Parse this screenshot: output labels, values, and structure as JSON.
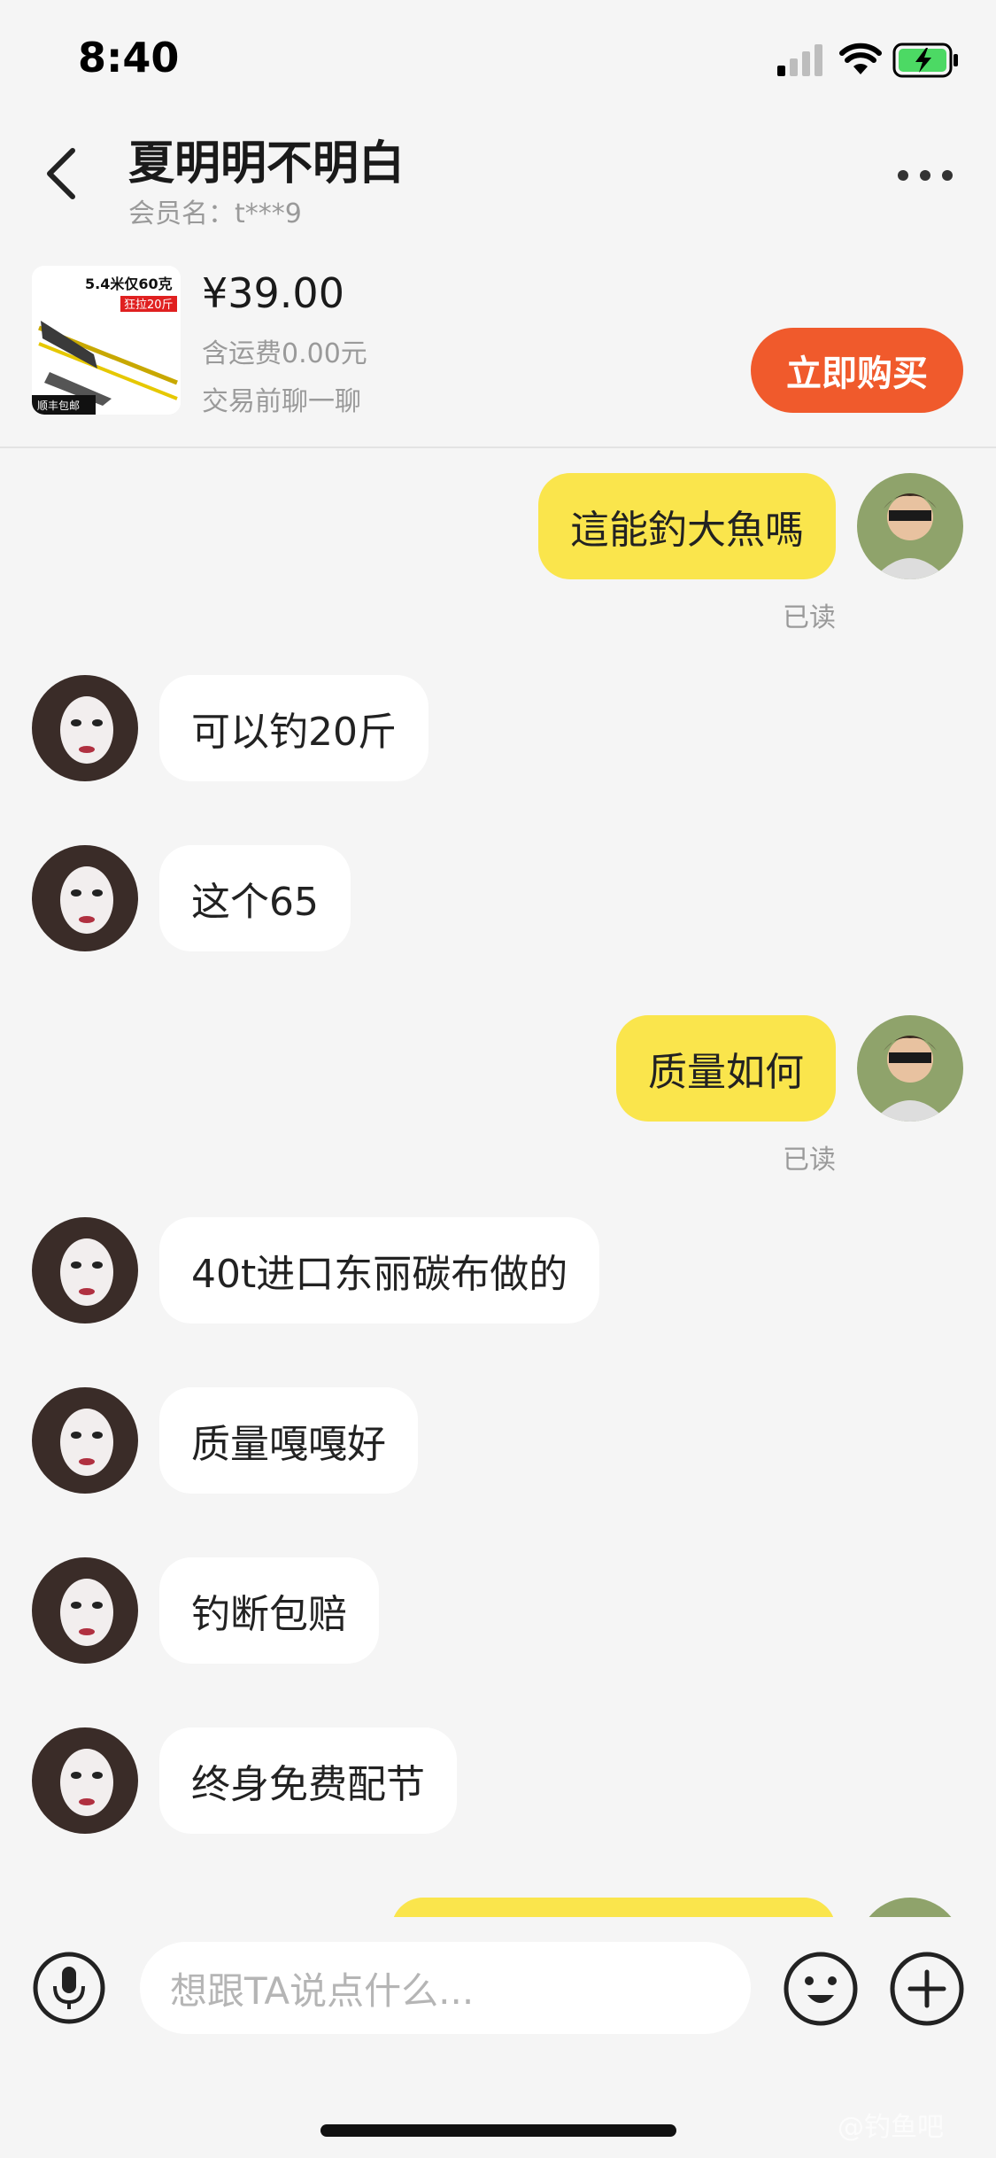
{
  "status_bar": {
    "time": "8:40",
    "icons": [
      "signal-icon",
      "wifi-icon",
      "battery-charging-icon"
    ]
  },
  "header": {
    "title": "夏明明不明白",
    "member": "会员名：t***9",
    "back_icon": "chevron-left-icon",
    "more_icon": "more-dots-icon"
  },
  "product": {
    "image_text": {
      "main": "5.4米仅60克",
      "tag": "狂拉20斤",
      "badge": "顺丰包邮"
    },
    "price": "¥39.00",
    "shipping": "含运费0.00元",
    "chat_hint": "交易前聊一聊",
    "buy_label": "立即购买",
    "buy_color": "#f05a2c"
  },
  "messages": [
    {
      "side": "out",
      "text": "這能釣大魚嗎",
      "status": "已读"
    },
    {
      "side": "in",
      "text": "可以钓20斤"
    },
    {
      "side": "in",
      "text": "这个65"
    },
    {
      "side": "out",
      "text": "质量如何",
      "status": "已读"
    },
    {
      "side": "in",
      "text": "40t进口东丽碳布做的"
    },
    {
      "side": "in",
      "text": "质量嘎嘎好"
    },
    {
      "side": "in",
      "text": "钓断包赔"
    },
    {
      "side": "in",
      "text": "终身免费配节"
    },
    {
      "side": "out",
      "text": ""
    }
  ],
  "input_bar": {
    "placeholder": "想跟TA说点什么...",
    "icons": [
      "microphone-icon",
      "emoji-icon",
      "plus-icon"
    ]
  },
  "watermark": "@钓鱼吧",
  "colors": {
    "outgoing_bubble": "#fae54c",
    "incoming_bubble": "#ffffff",
    "background": "#f5f5f5"
  }
}
